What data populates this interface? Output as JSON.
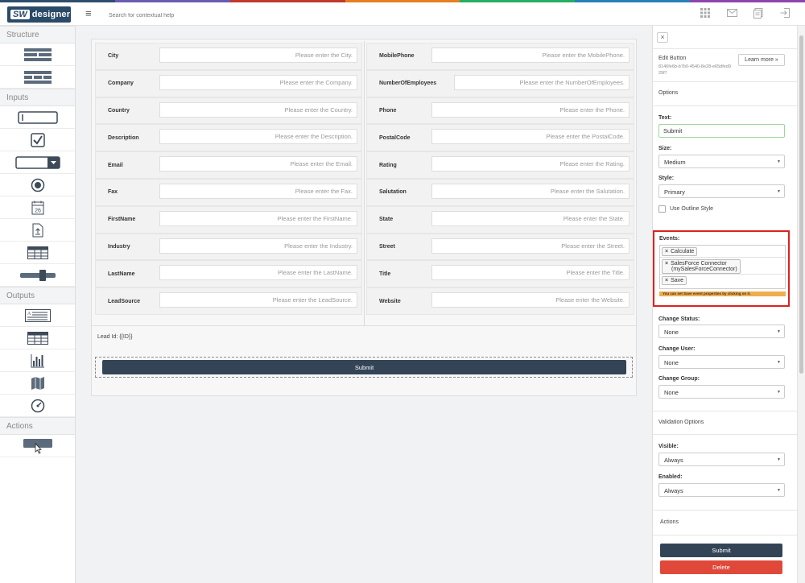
{
  "app": {
    "logo_mark": "SW",
    "logo_word": "designer",
    "search_placeholder": "Search for contextual help",
    "stripe_colors": [
      "#2e4d6d",
      "#6a5bb3",
      "#c0392b",
      "#e67e22",
      "#27ae60",
      "#2980b9",
      "#8e44ad"
    ]
  },
  "sidebar": {
    "structure_label": "Structure",
    "inputs_label": "Inputs",
    "outputs_label": "Outputs",
    "actions_label": "Actions",
    "date_icon_text": "26"
  },
  "form": {
    "left_fields": [
      {
        "label": "City",
        "placeholder": "Please enter the City."
      },
      {
        "label": "Company",
        "placeholder": "Please enter the Company."
      },
      {
        "label": "Country",
        "placeholder": "Please enter the Country."
      },
      {
        "label": "Description",
        "placeholder": "Please enter the Description."
      },
      {
        "label": "Email",
        "placeholder": "Please enter the Email."
      },
      {
        "label": "Fax",
        "placeholder": "Please enter the Fax."
      },
      {
        "label": "FirstName",
        "placeholder": "Please enter the FirstName."
      },
      {
        "label": "Industry",
        "placeholder": "Please enter the Industry."
      },
      {
        "label": "LastName",
        "placeholder": "Please enter the LastName."
      },
      {
        "label": "LeadSource",
        "placeholder": "Please enter the LeadSource."
      }
    ],
    "right_fields": [
      {
        "label": "MobilePhone",
        "placeholder": "Please enter the MobilePhone."
      },
      {
        "label": "NumberOfEmployees",
        "placeholder": "Please enter the NumberOfEmployees."
      },
      {
        "label": "Phone",
        "placeholder": "Please enter the Phone."
      },
      {
        "label": "PostalCode",
        "placeholder": "Please enter the PostalCode."
      },
      {
        "label": "Rating",
        "placeholder": "Please enter the Rating."
      },
      {
        "label": "Salutation",
        "placeholder": "Please enter the Salutation."
      },
      {
        "label": "State",
        "placeholder": "Please enter the State."
      },
      {
        "label": "Street",
        "placeholder": "Please enter the Street."
      },
      {
        "label": "Title",
        "placeholder": "Please enter the Title."
      },
      {
        "label": "Website",
        "placeholder": "Please enter the Website."
      }
    ],
    "lead_id": "Lead Id: {{ID}}",
    "submit_label": "Submit"
  },
  "panel": {
    "close": "×",
    "title": "Edit Button",
    "id": "8146fe6b-b7b0-4540-8e28-e65dfed929f7",
    "learn_more": "Learn more »",
    "options_label": "Options",
    "text_label": "Text:",
    "text_value": "Submit",
    "size_label": "Size:",
    "size_value": "Medium",
    "style_label": "Style:",
    "style_value": "Primary",
    "outline_label": "Use Outline Style",
    "events_label": "Events:",
    "events": [
      {
        "x": "×",
        "name": "Calculate"
      },
      {
        "x": "×",
        "name": "SalesForce Connector",
        "sub": "(mySalesForceConnector)"
      },
      {
        "x": "×",
        "name": "Save"
      }
    ],
    "events_hint": "You can set Save event properties by clicking on it.",
    "change_status_label": "Change Status:",
    "change_status_value": "None",
    "change_user_label": "Change User:",
    "change_user_value": "None",
    "change_group_label": "Change Group:",
    "change_group_value": "None",
    "validation_label": "Validation Options",
    "visible_label": "Visible:",
    "visible_value": "Always",
    "enabled_label": "Enabled:",
    "enabled_value": "Always",
    "actions_label": "Actions",
    "submit_btn": "Submit",
    "delete_btn": "Delete",
    "submit_color": "#344457",
    "delete_color": "#e0493a"
  }
}
